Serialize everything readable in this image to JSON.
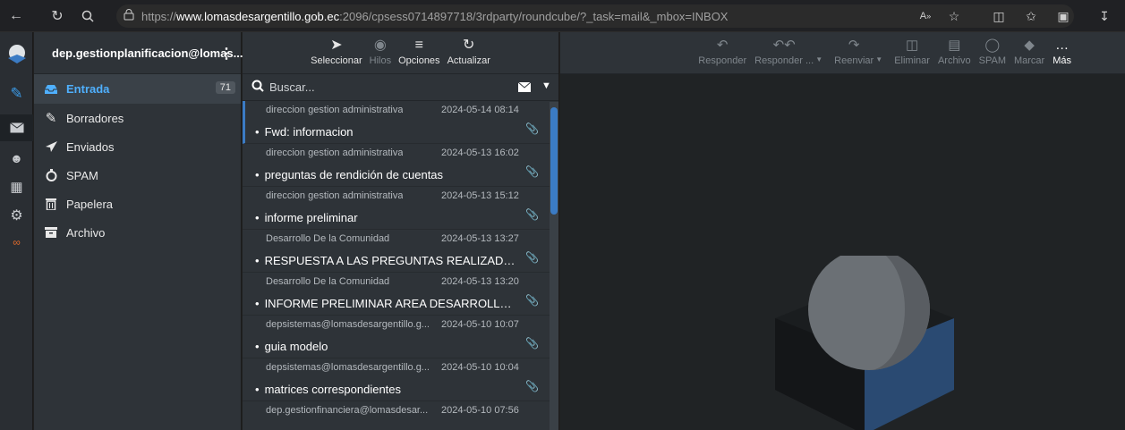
{
  "browser": {
    "url_prefix": "https://",
    "url_domain": "www.lomasdesargentillo.gob.ec",
    "url_rest": ":2096/cpsess0714897718/3rdparty/roundcube/?_task=mail&_mbox=INBOX",
    "icons": [
      "back-arrow-icon",
      "refresh-icon",
      "search-icon",
      "lock-icon",
      "read-aloud-icon",
      "favorite-icon",
      "split-screen-icon",
      "favorites-icon",
      "collections-icon",
      "downloads-icon"
    ]
  },
  "account": {
    "email": "dep.gestionplanificacion@lomas..."
  },
  "folders": [
    {
      "label": "Entrada",
      "count": "71",
      "icon": "inbox-icon"
    },
    {
      "label": "Borradores",
      "icon": "pencil-icon"
    },
    {
      "label": "Enviados",
      "icon": "paper-plane-icon"
    },
    {
      "label": "SPAM",
      "icon": "fire-icon"
    },
    {
      "label": "Papelera",
      "icon": "trash-icon"
    },
    {
      "label": "Archivo",
      "icon": "archive-icon"
    }
  ],
  "list_toolbar": {
    "select": "Seleccionar",
    "threads": "Hilos",
    "options": "Opciones",
    "refresh": "Actualizar"
  },
  "search": {
    "placeholder": "Buscar..."
  },
  "messages": [
    {
      "from": "direccion gestion administrativa",
      "date": "2024-05-14 08:14",
      "subject": "Fwd: informacion"
    },
    {
      "from": "direccion gestion administrativa",
      "date": "2024-05-13 16:02",
      "subject": "preguntas de rendición de cuentas"
    },
    {
      "from": "direccion gestion administrativa",
      "date": "2024-05-13 15:12",
      "subject": "informe preliminar"
    },
    {
      "from": "Desarrollo De la Comunidad",
      "date": "2024-05-13 13:27",
      "subject": "RESPUESTA A LAS PREGUNTAS REALIZADAS PO..."
    },
    {
      "from": "Desarrollo De la Comunidad",
      "date": "2024-05-13 13:20",
      "subject": "INFORME PRELIMINAR AREA DESARROLLO COM..."
    },
    {
      "from": "depsistemas@lomasdesargentillo.g...",
      "date": "2024-05-10 10:07",
      "subject": "guia modelo"
    },
    {
      "from": "depsistemas@lomasdesargentillo.g...",
      "date": "2024-05-10 10:04",
      "subject": "matrices correspondientes"
    },
    {
      "from": "dep.gestionfinanciera@lomasdesar...",
      "date": "2024-05-10 07:56",
      "subject": ""
    }
  ],
  "message_toolbar": {
    "reply": "Responder",
    "reply_all": "Responder ...",
    "forward": "Reenviar",
    "delete": "Eliminar",
    "archive": "Archivo",
    "spam": "SPAM",
    "mark": "Marcar",
    "more": "Más"
  },
  "colors": {
    "accent": "#4fb0ff",
    "selected_bar": "#3b7bc4",
    "panel": "#2e3338",
    "rail": "#2a2e33"
  }
}
